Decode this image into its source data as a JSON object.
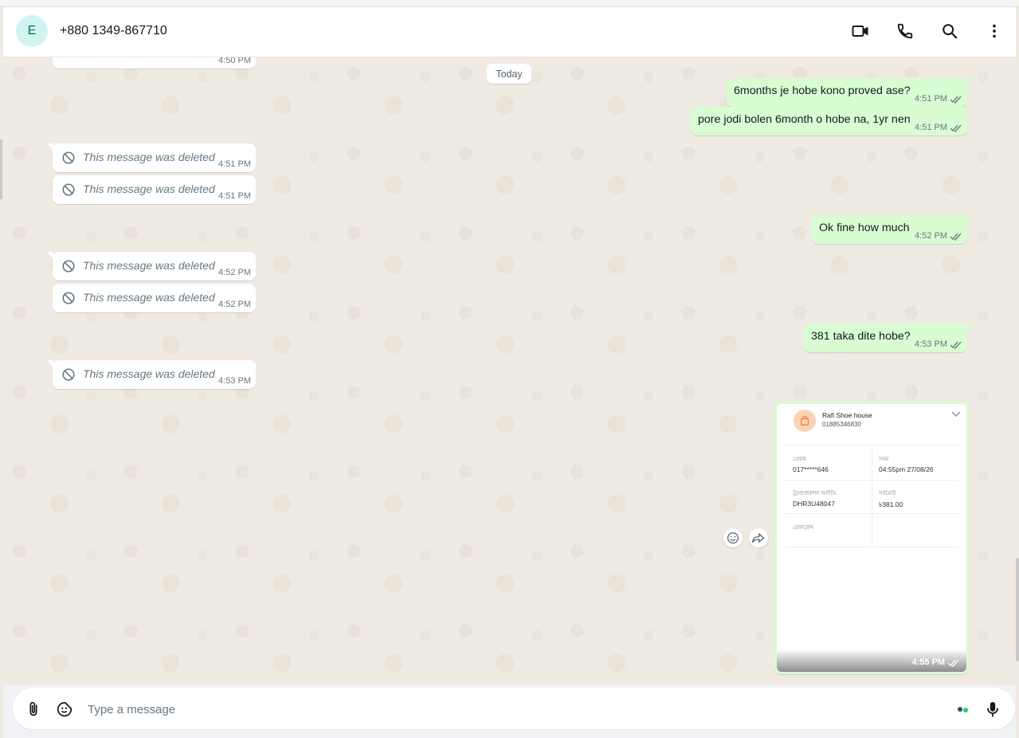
{
  "header": {
    "avatar_letter": "E",
    "contact_name": "+880 1349-867710",
    "icons": [
      "video-call-icon",
      "voice-call-icon",
      "search-icon",
      "menu-icon"
    ]
  },
  "chat": {
    "date_separator": "Today",
    "partial_top_time": "4:50 PM",
    "messages": [
      {
        "direction": "out",
        "text": "6months je hobe kono proved ase?",
        "time": "4:51 PM"
      },
      {
        "direction": "out",
        "text": "pore jodi bolen 6month o hobe na, 1yr nen",
        "time": "4:51 PM"
      },
      {
        "direction": "in",
        "deleted": true,
        "text": "This message was deleted",
        "time": "4:51 PM"
      },
      {
        "direction": "in",
        "deleted": true,
        "text": "This message was deleted",
        "time": "4:51 PM"
      },
      {
        "direction": "out",
        "text": "Ok fine how much",
        "time": "4:52 PM"
      },
      {
        "direction": "in",
        "deleted": true,
        "text": "This message was deleted",
        "time": "4:52 PM"
      },
      {
        "direction": "in",
        "deleted": true,
        "text": "This message was deleted",
        "time": "4:52 PM"
      },
      {
        "direction": "out",
        "text": "381 taka dite hobe?",
        "time": "4:53 PM"
      },
      {
        "direction": "in",
        "deleted": true,
        "text": "This message was deleted",
        "time": "4:53 PM"
      }
    ],
    "receipt": {
      "merchant": "Rafi Shoe house",
      "merchant_phone": "01885346830",
      "customer_label": "প্রেরক",
      "customer_value": "017*****646",
      "time_label": "সময়",
      "time_value": "04:55pm 27/08/26",
      "trx_label": "ট্রানজেকশন আইডি",
      "trx_value": "DHR3U48047",
      "amount_label": "সর্বমোট",
      "amount_value": "৳381.00",
      "ref_label": "রেফারেন্স",
      "time": "4:55 PM"
    }
  },
  "composer": {
    "placeholder": "Type a message"
  },
  "colors": {
    "outgoing_bubble": "#d9fdd3",
    "incoming_bubble": "#ffffff",
    "chat_bg": "#efeae2",
    "read_tick": "#667781"
  }
}
